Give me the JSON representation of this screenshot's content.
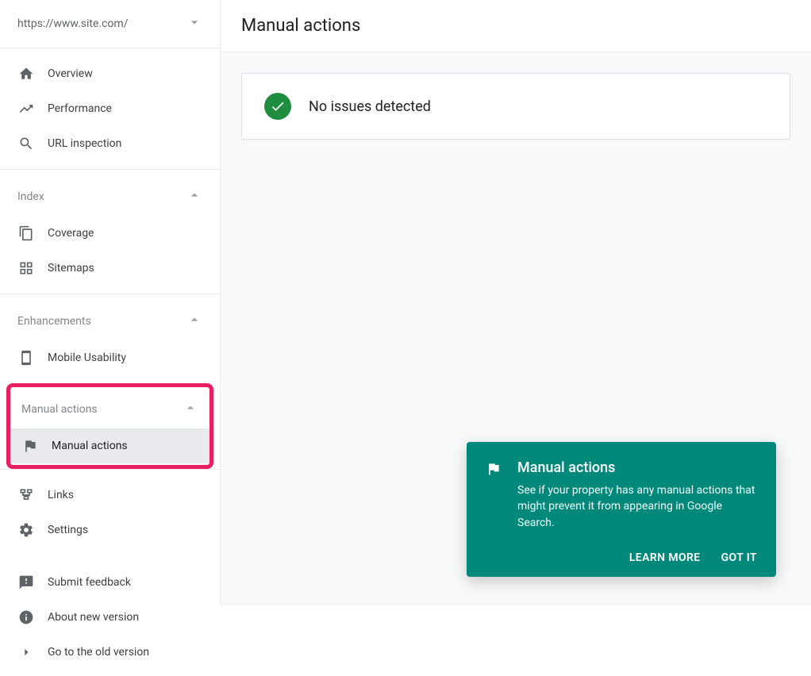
{
  "property": {
    "url": "https://www.site.com/"
  },
  "header": {
    "title": "Manual actions"
  },
  "sidebar": {
    "top": [
      {
        "label": "Overview"
      },
      {
        "label": "Performance"
      },
      {
        "label": "URL inspection"
      }
    ],
    "index": {
      "title": "Index",
      "items": [
        {
          "label": "Coverage"
        },
        {
          "label": "Sitemaps"
        }
      ]
    },
    "enhancements": {
      "title": "Enhancements",
      "items": [
        {
          "label": "Mobile Usability"
        }
      ]
    },
    "manual": {
      "title": "Manual actions",
      "items": [
        {
          "label": "Manual actions"
        }
      ]
    },
    "bottom": [
      {
        "label": "Links"
      },
      {
        "label": "Settings"
      }
    ],
    "footer": [
      {
        "label": "Submit feedback"
      },
      {
        "label": "About new version"
      },
      {
        "label": "Go to the old version"
      }
    ]
  },
  "status": {
    "message": "No issues detected"
  },
  "toast": {
    "title": "Manual actions",
    "body": "See if your property has any manual actions that might prevent it from appearing in Google Search.",
    "learn": "LEARN MORE",
    "gotit": "GOT IT"
  }
}
